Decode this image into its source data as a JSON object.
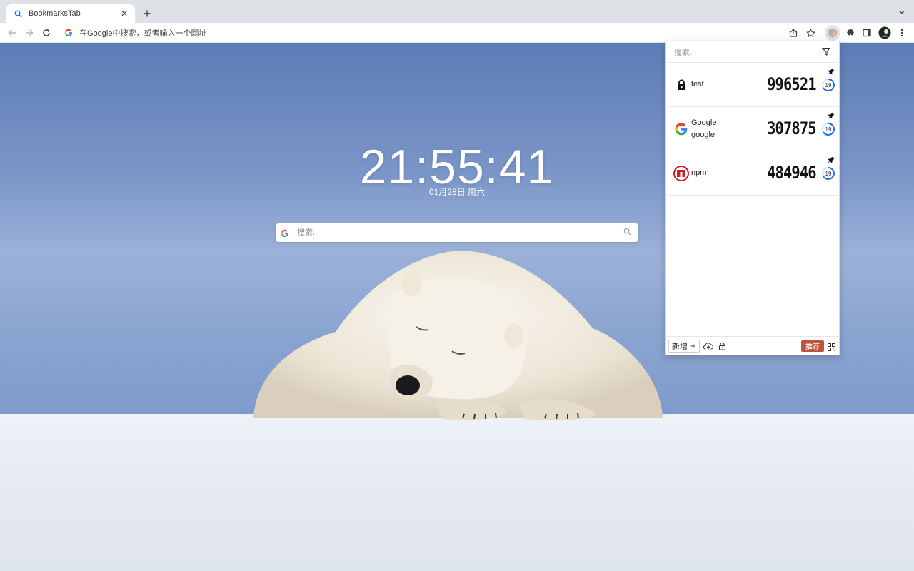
{
  "browser": {
    "tab_title": "BookmarksTab",
    "new_tab_symbol": "+",
    "close_symbol": "✕",
    "omnibox_placeholder": "在Google中搜索，或者输入一个网址"
  },
  "newtab": {
    "clock": "21:55:41",
    "date": "01月28日 周六",
    "search_placeholder": "搜索.."
  },
  "popup": {
    "search_placeholder": "搜索..",
    "entries": [
      {
        "name": "test",
        "account": "",
        "code": "996521",
        "countdown": "19",
        "icon": "lock-icon"
      },
      {
        "name": "Google",
        "account": "google",
        "code": "307875",
        "countdown": "19",
        "icon": "google-icon"
      },
      {
        "name": "npm",
        "account": "",
        "code": "484946",
        "countdown": "19",
        "icon": "npm-icon"
      }
    ],
    "footer": {
      "add_label": "新增",
      "add_symbol": "+",
      "recommend_label": "推荐"
    }
  },
  "colors": {
    "accent_blue": "#1a73e8",
    "recommend_red": "#c0533d",
    "npm_red": "#c12127"
  }
}
